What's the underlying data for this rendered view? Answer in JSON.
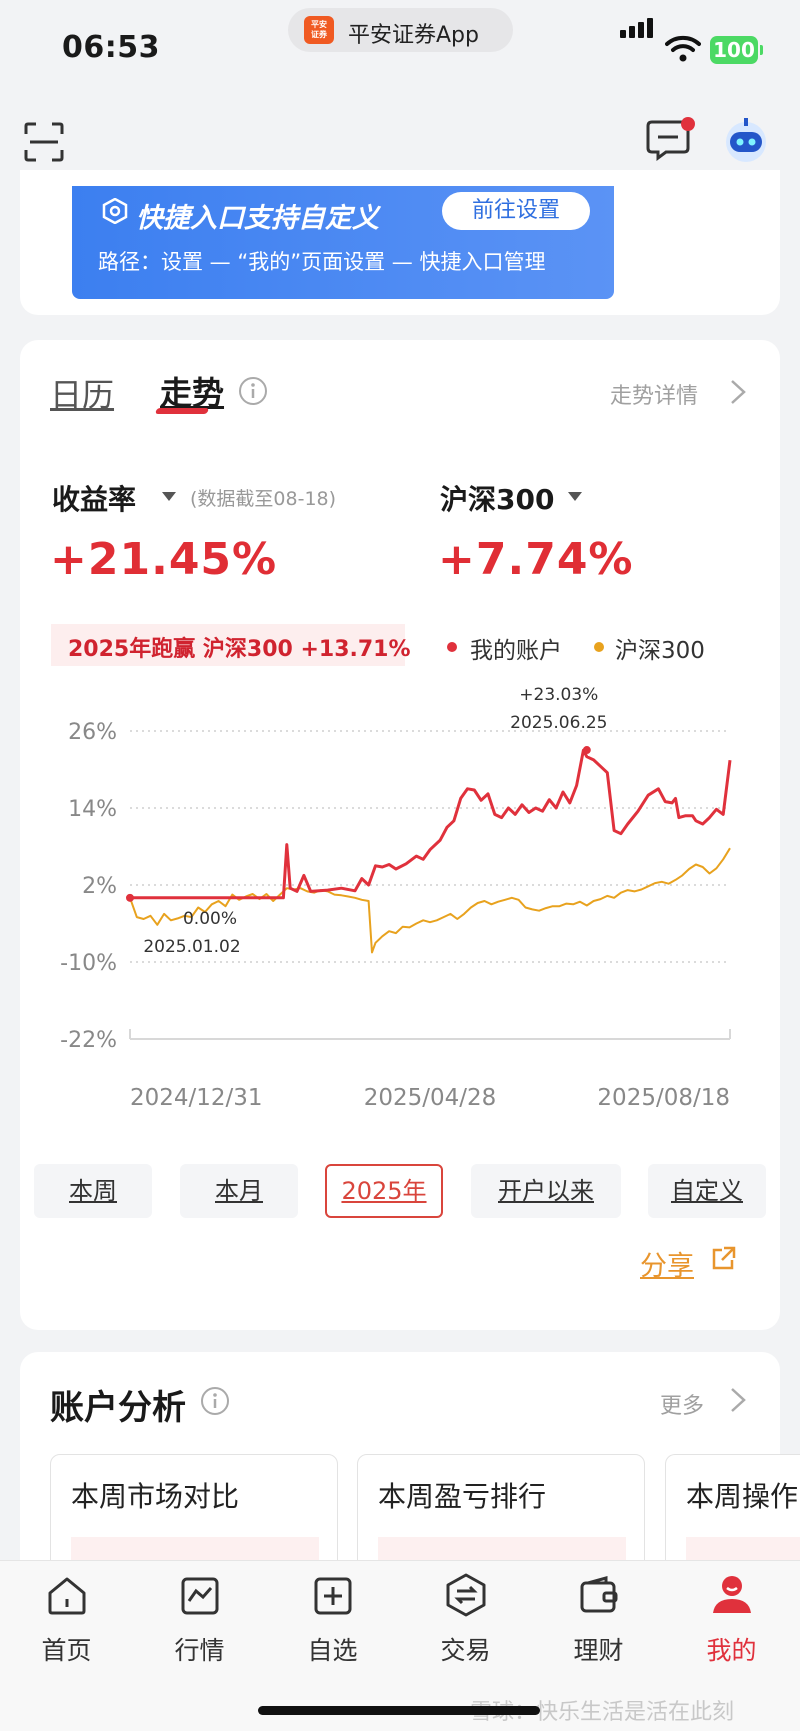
{
  "status_bar": {
    "time": "06:53",
    "app_name": "平安证券App",
    "app_logo_text": "平安证券",
    "battery": "100"
  },
  "banner": {
    "title": "快捷入口支持自定义",
    "button": "前往设置",
    "path": "路径：设置 — “我的”页面设置 — 快捷入口管理"
  },
  "trend_card": {
    "tabs": [
      "日历",
      "走势"
    ],
    "active_tab": "走势",
    "detail_link": "走势详情",
    "metric1": {
      "label": "收益率",
      "note": "(数据截至08-18)",
      "value": "+21.45%"
    },
    "metric2": {
      "label": "沪深300",
      "value": "+7.74%"
    },
    "beat_text": "2025年跑赢 沪深300 +13.71%",
    "legend": [
      {
        "label": "我的账户",
        "color": "#e0313c"
      },
      {
        "label": "沪深300",
        "color": "#e8a21e"
      }
    ],
    "ranges": [
      "本周",
      "本月",
      "2025年",
      "开户以来",
      "自定义"
    ],
    "active_range": "2025年",
    "share": "分享"
  },
  "chart_data": {
    "type": "line",
    "y_ticks": [
      "26%",
      "14%",
      "2%",
      "-10%",
      "-22%"
    ],
    "y_tick_values": [
      26,
      14,
      2,
      -10,
      -22
    ],
    "ylim": [
      -22,
      26
    ],
    "x_tick_labels": [
      "2024/12/31",
      "2025/04/28",
      "2025/08/18"
    ],
    "grid": true,
    "annotations": [
      {
        "value_text": "+23.03%",
        "date_text": "2025.06.25",
        "x": 134,
        "y": 23.03
      },
      {
        "value_text": "0.00%",
        "date_text": "2025.01.02",
        "x": 0,
        "y": 0
      }
    ],
    "xlim": [
      0,
      165
    ],
    "series": [
      {
        "name": "我的账户",
        "color": "#e0313c",
        "points": [
          [
            0,
            0
          ],
          [
            45,
            0
          ],
          [
            46,
            8.3
          ],
          [
            47,
            1.5
          ],
          [
            49,
            1
          ],
          [
            51,
            3.5
          ],
          [
            53,
            1
          ],
          [
            58,
            1.2
          ],
          [
            62,
            1.5
          ],
          [
            66,
            1.1
          ],
          [
            68,
            3
          ],
          [
            70,
            2
          ],
          [
            72,
            5
          ],
          [
            74,
            4.8
          ],
          [
            76,
            5.2
          ],
          [
            78,
            4.5
          ],
          [
            81,
            5.3
          ],
          [
            84,
            6.5
          ],
          [
            86,
            6
          ],
          [
            88,
            7.5
          ],
          [
            91,
            9
          ],
          [
            93,
            11
          ],
          [
            95,
            12
          ],
          [
            97,
            15.5
          ],
          [
            99,
            17
          ],
          [
            101,
            16.8
          ],
          [
            103,
            15.2
          ],
          [
            105,
            16.2
          ],
          [
            107,
            13
          ],
          [
            109,
            12.5
          ],
          [
            111,
            14
          ],
          [
            113,
            13
          ],
          [
            115,
            14.5
          ],
          [
            117,
            13.3
          ],
          [
            119,
            14
          ],
          [
            121,
            13.5
          ],
          [
            123,
            15.3
          ],
          [
            125,
            14
          ],
          [
            127,
            16.5
          ],
          [
            129,
            14.8
          ],
          [
            131,
            17.5
          ],
          [
            133,
            23
          ],
          [
            134,
            22
          ],
          [
            136,
            21.5
          ],
          [
            138,
            20.5
          ],
          [
            140,
            19.5
          ],
          [
            142,
            10.5
          ],
          [
            144,
            10
          ],
          [
            146,
            11.5
          ],
          [
            149,
            13.5
          ],
          [
            152,
            16
          ],
          [
            155,
            17
          ],
          [
            157,
            15
          ],
          [
            159,
            14.8
          ],
          [
            160,
            15.5
          ],
          [
            161,
            12.5
          ],
          [
            163,
            12.8
          ],
          [
            165,
            12.8
          ],
          [
            166,
            12
          ],
          [
            168,
            11.5
          ],
          [
            170,
            12.5
          ],
          [
            172,
            13.8
          ],
          [
            174,
            13
          ],
          [
            176,
            21.45
          ]
        ]
      },
      {
        "name": "沪深300",
        "color": "#e8a21e",
        "points": [
          [
            0,
            0
          ],
          [
            2,
            -3
          ],
          [
            4,
            -3.3
          ],
          [
            6,
            -2.8
          ],
          [
            8,
            -4.2
          ],
          [
            10,
            -2.5
          ],
          [
            12,
            -3.5
          ],
          [
            14,
            -3.2
          ],
          [
            16,
            -2.8
          ],
          [
            18,
            -3
          ],
          [
            20,
            -1.5
          ],
          [
            22,
            -2.2
          ],
          [
            24,
            -1
          ],
          [
            26,
            -0.5
          ],
          [
            28,
            -1.3
          ],
          [
            30,
            0.5
          ],
          [
            32,
            -0.3
          ],
          [
            34,
            0.2
          ],
          [
            36,
            0.6
          ],
          [
            38,
            -0.2
          ],
          [
            40,
            0.6
          ],
          [
            42,
            -0.5
          ],
          [
            44,
            0.5
          ],
          [
            46,
            1.5
          ],
          [
            48,
            1.3
          ],
          [
            50,
            1.5
          ],
          [
            52,
            1
          ],
          [
            54,
            0.8
          ],
          [
            56,
            1.2
          ],
          [
            58,
            1
          ],
          [
            60,
            0.5
          ],
          [
            62,
            0.4
          ],
          [
            64,
            0.2
          ],
          [
            66,
            0
          ],
          [
            68,
            -0.3
          ],
          [
            70,
            -0.5
          ],
          [
            71,
            -8.5
          ],
          [
            72,
            -7
          ],
          [
            74,
            -6
          ],
          [
            76,
            -5.2
          ],
          [
            78,
            -5.5
          ],
          [
            80,
            -4.5
          ],
          [
            82,
            -4.6
          ],
          [
            84,
            -4
          ],
          [
            86,
            -3.5
          ],
          [
            88,
            -3.8
          ],
          [
            90,
            -3.5
          ],
          [
            92,
            -3
          ],
          [
            94,
            -2.5
          ],
          [
            96,
            -3.3
          ],
          [
            98,
            -2.5
          ],
          [
            100,
            -1.5
          ],
          [
            102,
            -0.8
          ],
          [
            104,
            -0.5
          ],
          [
            106,
            -1
          ],
          [
            108,
            -0.6
          ],
          [
            110,
            -0.3
          ],
          [
            112,
            0
          ],
          [
            114,
            -0.3
          ],
          [
            116,
            -1.5
          ],
          [
            118,
            -1.8
          ],
          [
            120,
            -2
          ],
          [
            122,
            -1.6
          ],
          [
            124,
            -1.3
          ],
          [
            126,
            -1.3
          ],
          [
            128,
            -0.9
          ],
          [
            130,
            -1
          ],
          [
            132,
            -0.6
          ],
          [
            134,
            -1.2
          ],
          [
            136,
            -0.5
          ],
          [
            138,
            -0.2
          ],
          [
            140,
            0.3
          ],
          [
            142,
            0
          ],
          [
            144,
            0.8
          ],
          [
            146,
            1.2
          ],
          [
            148,
            1
          ],
          [
            150,
            1.3
          ],
          [
            152,
            1.8
          ],
          [
            154,
            2.3
          ],
          [
            156,
            2.5
          ],
          [
            158,
            2.2
          ],
          [
            160,
            2.8
          ],
          [
            162,
            3.5
          ],
          [
            164,
            4.5
          ],
          [
            166,
            5.2
          ],
          [
            168,
            4.8
          ],
          [
            170,
            3.8
          ],
          [
            172,
            4.6
          ],
          [
            174,
            6
          ],
          [
            176,
            7.74
          ]
        ]
      }
    ]
  },
  "analysis": {
    "title": "账户分析",
    "more": "更多",
    "cards": [
      "本周市场对比",
      "本周盈亏排行",
      "本周操作"
    ]
  },
  "bottom_nav": {
    "items": [
      {
        "label": "首页",
        "icon": "home-icon"
      },
      {
        "label": "行情",
        "icon": "chart-icon"
      },
      {
        "label": "自选",
        "icon": "add-icon"
      },
      {
        "label": "交易",
        "icon": "exchange-icon"
      },
      {
        "label": "理财",
        "icon": "wallet-icon"
      },
      {
        "label": "我的",
        "icon": "profile-icon"
      }
    ],
    "active": "我的"
  },
  "watermark": "雪球：快乐生活是活在此刻"
}
